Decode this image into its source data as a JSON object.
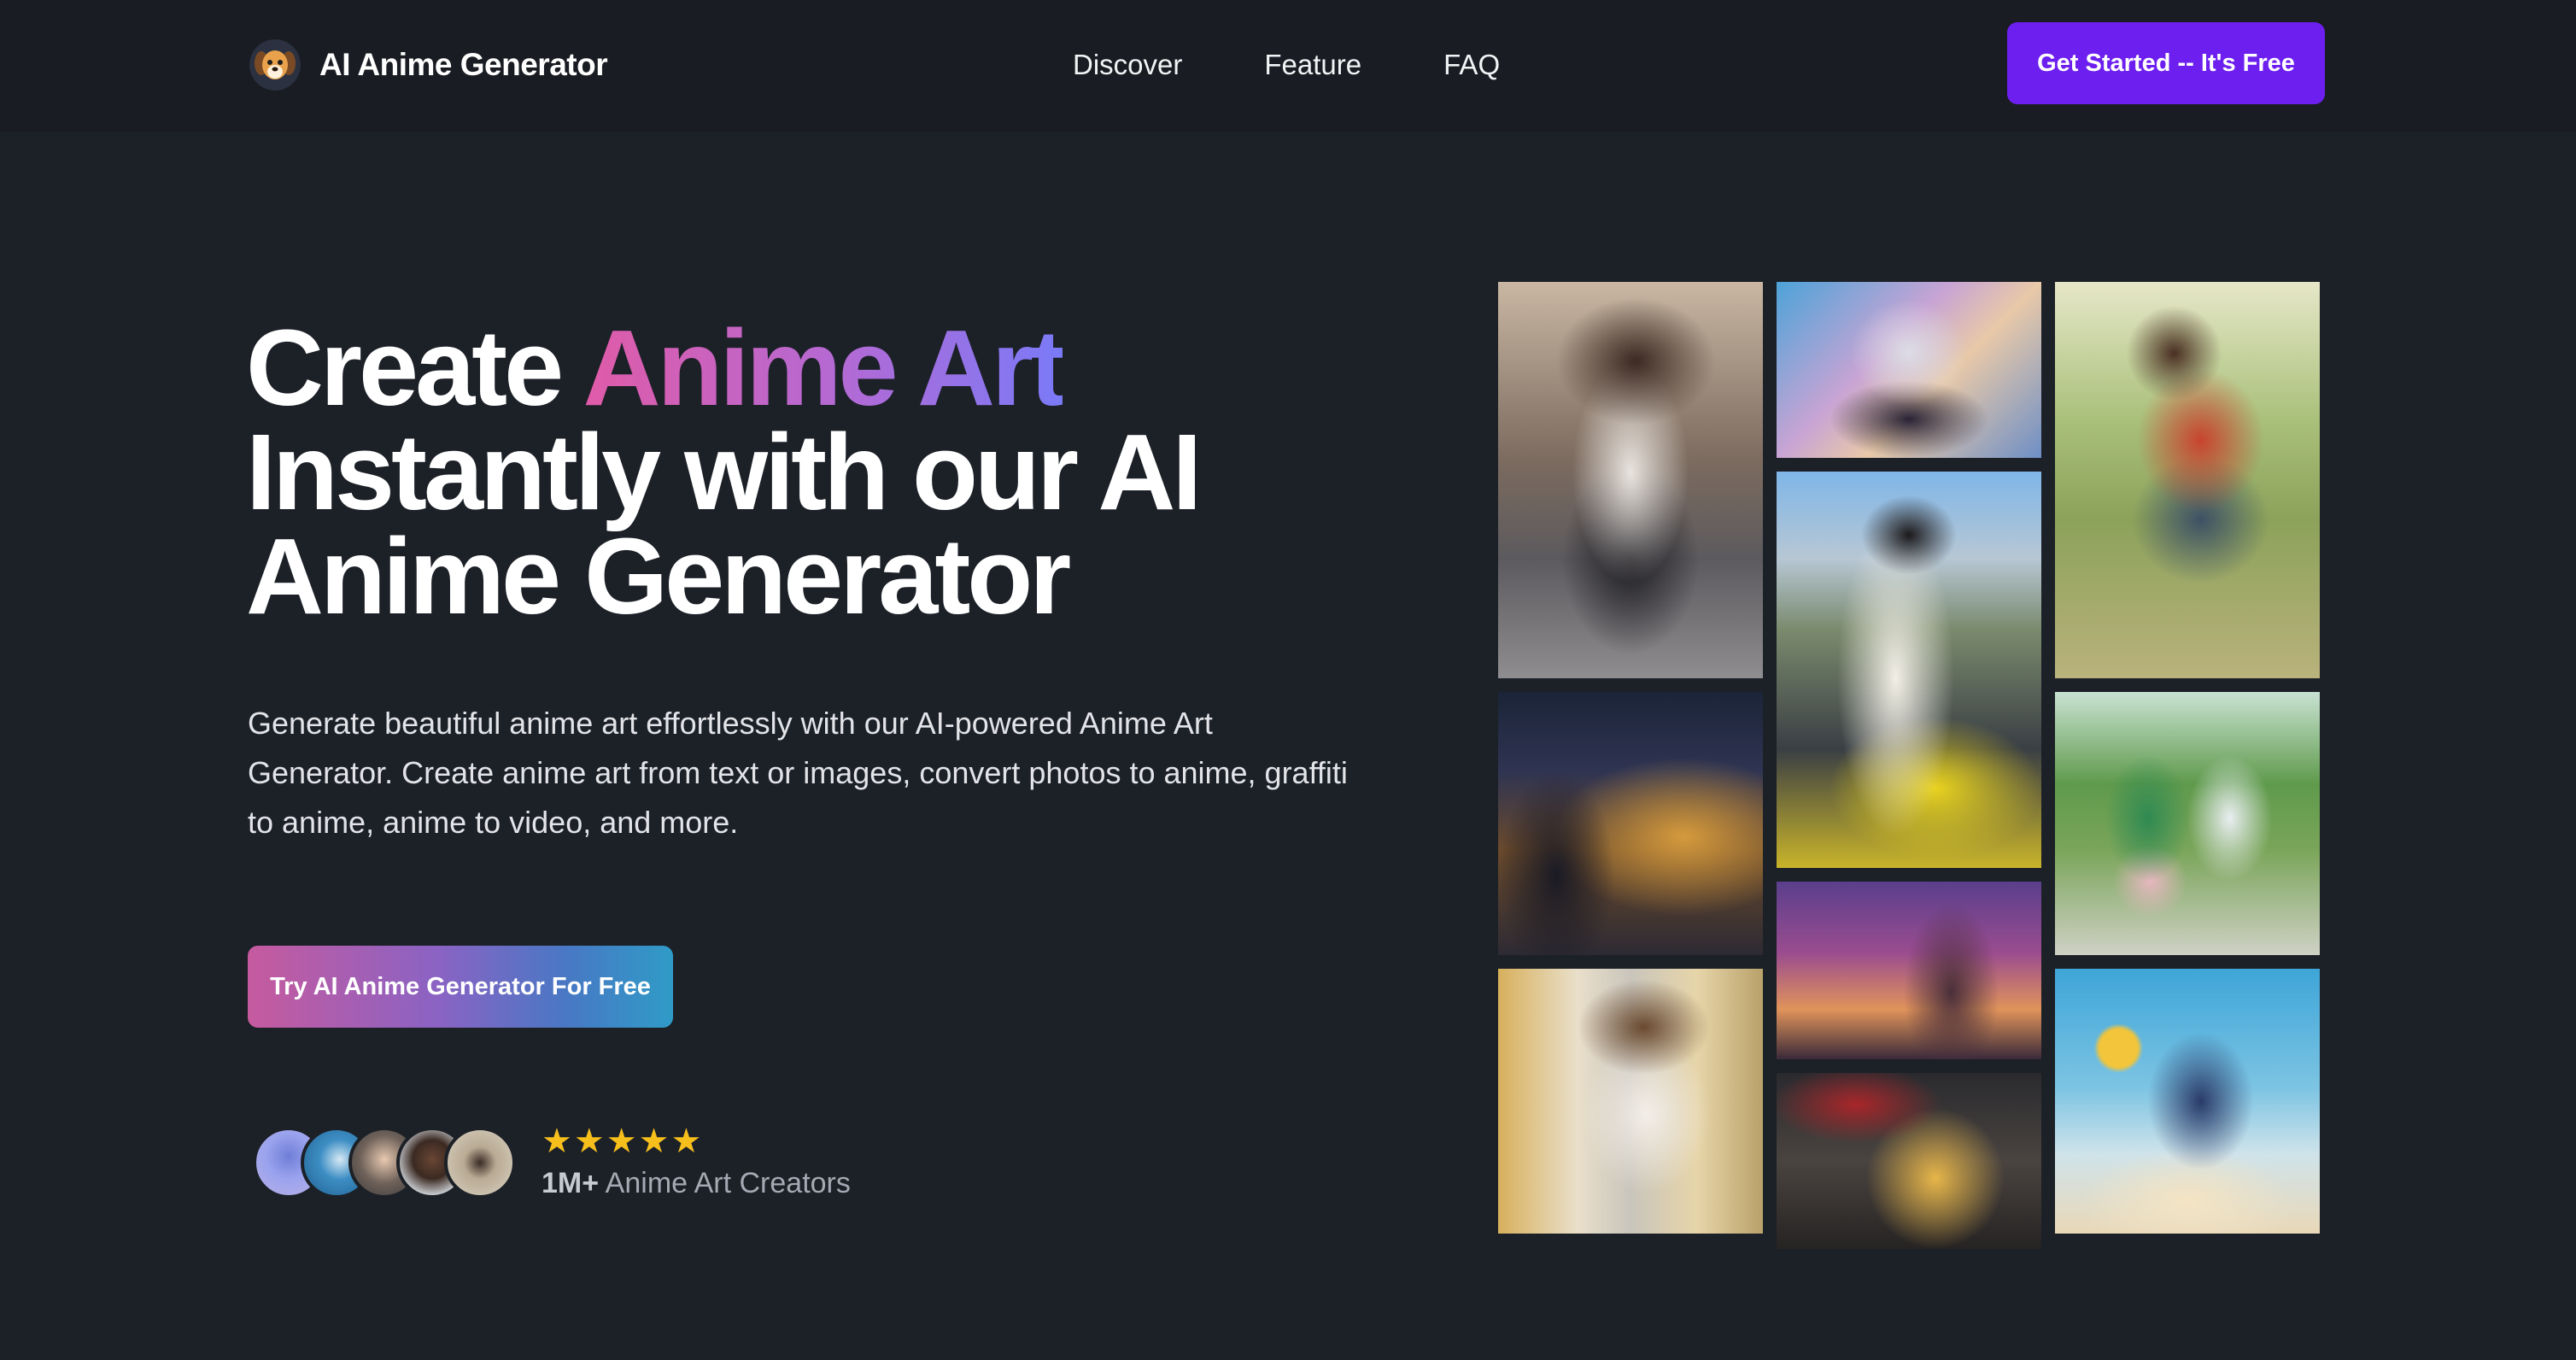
{
  "header": {
    "brand_name": "AI Anime Generator",
    "logo_icon": "dog-head-logo",
    "nav": [
      "Discover",
      "Feature",
      "FAQ"
    ],
    "cta_label": "Get Started -- It's Free"
  },
  "hero": {
    "headline_before": "Create ",
    "headline_highlight": "Anime Art",
    "headline_after": " Instantly with our AI Anime Generator",
    "description": "Generate beautiful anime art effortlessly with our AI-powered Anime Art Generator. Create anime art from text or images, convert photos to anime, graffiti to anime, anime to video, and more.",
    "button_label": "Try AI Anime Generator For Free",
    "rating_stars": 5,
    "count": "1M+",
    "count_label": "Anime Art Creators"
  },
  "colors": {
    "background": "#1c2027",
    "header_background": "#191c22",
    "cta": "#6d1ff0",
    "star": "#f6bf1c"
  },
  "gallery": [
    "girl-on-city-street-image",
    "cat-ear-maid-girl-image",
    "boy-sitting-in-park-image",
    "racing-suit-girl-image",
    "girl-on-night-city-balcony-image",
    "couple-walking-in-park-image",
    "fantasy-cathedral-sunset-image",
    "girl-in-store-aisle-image",
    "boy-with-red-umbrella-image",
    "winged-girl-in-sky-image"
  ]
}
